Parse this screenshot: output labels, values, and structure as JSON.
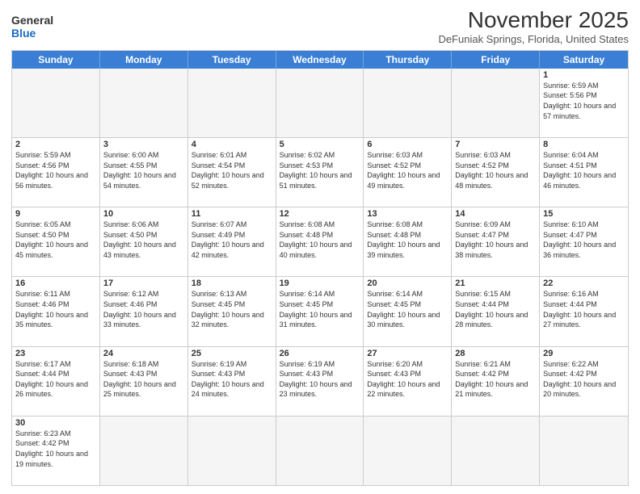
{
  "header": {
    "logo_general": "General",
    "logo_blue": "Blue",
    "month_title": "November 2025",
    "location": "DeFuniak Springs, Florida, United States"
  },
  "day_headers": [
    "Sunday",
    "Monday",
    "Tuesday",
    "Wednesday",
    "Thursday",
    "Friday",
    "Saturday"
  ],
  "weeks": [
    [
      {
        "day": "",
        "info": ""
      },
      {
        "day": "",
        "info": ""
      },
      {
        "day": "",
        "info": ""
      },
      {
        "day": "",
        "info": ""
      },
      {
        "day": "",
        "info": ""
      },
      {
        "day": "",
        "info": ""
      },
      {
        "day": "1",
        "info": "Sunrise: 6:59 AM\nSunset: 5:56 PM\nDaylight: 10 hours and 57 minutes."
      }
    ],
    [
      {
        "day": "2",
        "info": "Sunrise: 5:59 AM\nSunset: 4:56 PM\nDaylight: 10 hours and 56 minutes."
      },
      {
        "day": "3",
        "info": "Sunrise: 6:00 AM\nSunset: 4:55 PM\nDaylight: 10 hours and 54 minutes."
      },
      {
        "day": "4",
        "info": "Sunrise: 6:01 AM\nSunset: 4:54 PM\nDaylight: 10 hours and 52 minutes."
      },
      {
        "day": "5",
        "info": "Sunrise: 6:02 AM\nSunset: 4:53 PM\nDaylight: 10 hours and 51 minutes."
      },
      {
        "day": "6",
        "info": "Sunrise: 6:03 AM\nSunset: 4:52 PM\nDaylight: 10 hours and 49 minutes."
      },
      {
        "day": "7",
        "info": "Sunrise: 6:03 AM\nSunset: 4:52 PM\nDaylight: 10 hours and 48 minutes."
      },
      {
        "day": "8",
        "info": "Sunrise: 6:04 AM\nSunset: 4:51 PM\nDaylight: 10 hours and 46 minutes."
      }
    ],
    [
      {
        "day": "9",
        "info": "Sunrise: 6:05 AM\nSunset: 4:50 PM\nDaylight: 10 hours and 45 minutes."
      },
      {
        "day": "10",
        "info": "Sunrise: 6:06 AM\nSunset: 4:50 PM\nDaylight: 10 hours and 43 minutes."
      },
      {
        "day": "11",
        "info": "Sunrise: 6:07 AM\nSunset: 4:49 PM\nDaylight: 10 hours and 42 minutes."
      },
      {
        "day": "12",
        "info": "Sunrise: 6:08 AM\nSunset: 4:48 PM\nDaylight: 10 hours and 40 minutes."
      },
      {
        "day": "13",
        "info": "Sunrise: 6:08 AM\nSunset: 4:48 PM\nDaylight: 10 hours and 39 minutes."
      },
      {
        "day": "14",
        "info": "Sunrise: 6:09 AM\nSunset: 4:47 PM\nDaylight: 10 hours and 38 minutes."
      },
      {
        "day": "15",
        "info": "Sunrise: 6:10 AM\nSunset: 4:47 PM\nDaylight: 10 hours and 36 minutes."
      }
    ],
    [
      {
        "day": "16",
        "info": "Sunrise: 6:11 AM\nSunset: 4:46 PM\nDaylight: 10 hours and 35 minutes."
      },
      {
        "day": "17",
        "info": "Sunrise: 6:12 AM\nSunset: 4:46 PM\nDaylight: 10 hours and 33 minutes."
      },
      {
        "day": "18",
        "info": "Sunrise: 6:13 AM\nSunset: 4:45 PM\nDaylight: 10 hours and 32 minutes."
      },
      {
        "day": "19",
        "info": "Sunrise: 6:14 AM\nSunset: 4:45 PM\nDaylight: 10 hours and 31 minutes."
      },
      {
        "day": "20",
        "info": "Sunrise: 6:14 AM\nSunset: 4:45 PM\nDaylight: 10 hours and 30 minutes."
      },
      {
        "day": "21",
        "info": "Sunrise: 6:15 AM\nSunset: 4:44 PM\nDaylight: 10 hours and 28 minutes."
      },
      {
        "day": "22",
        "info": "Sunrise: 6:16 AM\nSunset: 4:44 PM\nDaylight: 10 hours and 27 minutes."
      }
    ],
    [
      {
        "day": "23",
        "info": "Sunrise: 6:17 AM\nSunset: 4:44 PM\nDaylight: 10 hours and 26 minutes."
      },
      {
        "day": "24",
        "info": "Sunrise: 6:18 AM\nSunset: 4:43 PM\nDaylight: 10 hours and 25 minutes."
      },
      {
        "day": "25",
        "info": "Sunrise: 6:19 AM\nSunset: 4:43 PM\nDaylight: 10 hours and 24 minutes."
      },
      {
        "day": "26",
        "info": "Sunrise: 6:19 AM\nSunset: 4:43 PM\nDaylight: 10 hours and 23 minutes."
      },
      {
        "day": "27",
        "info": "Sunrise: 6:20 AM\nSunset: 4:43 PM\nDaylight: 10 hours and 22 minutes."
      },
      {
        "day": "28",
        "info": "Sunrise: 6:21 AM\nSunset: 4:42 PM\nDaylight: 10 hours and 21 minutes."
      },
      {
        "day": "29",
        "info": "Sunrise: 6:22 AM\nSunset: 4:42 PM\nDaylight: 10 hours and 20 minutes."
      }
    ],
    [
      {
        "day": "30",
        "info": "Sunrise: 6:23 AM\nSunset: 4:42 PM\nDaylight: 10 hours and 19 minutes."
      },
      {
        "day": "",
        "info": ""
      },
      {
        "day": "",
        "info": ""
      },
      {
        "day": "",
        "info": ""
      },
      {
        "day": "",
        "info": ""
      },
      {
        "day": "",
        "info": ""
      },
      {
        "day": "",
        "info": ""
      }
    ]
  ]
}
